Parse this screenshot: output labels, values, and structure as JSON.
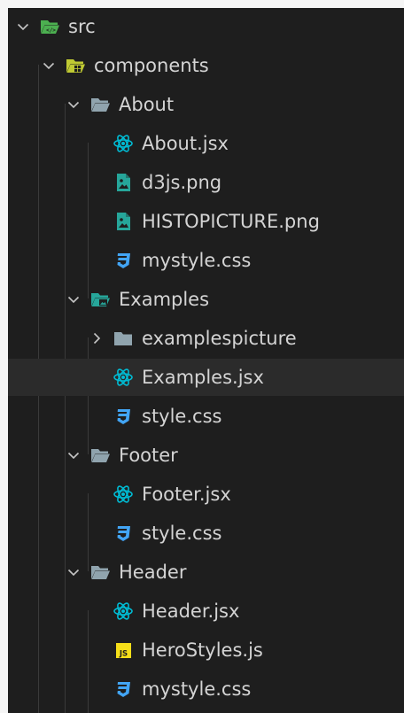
{
  "explorer": {
    "items": [
      {
        "label": "src",
        "kind": "folder",
        "expanded": true,
        "icon": "src-folder-open-icon",
        "depth": 0
      },
      {
        "label": "components",
        "kind": "folder",
        "expanded": true,
        "icon": "components-folder-open-icon",
        "depth": 1
      },
      {
        "label": "About",
        "kind": "folder",
        "expanded": true,
        "icon": "folder-open-icon",
        "depth": 2
      },
      {
        "label": "About.jsx",
        "kind": "file",
        "icon": "react-icon",
        "depth": 3
      },
      {
        "label": "d3js.png",
        "kind": "file",
        "icon": "image-file-icon",
        "depth": 3
      },
      {
        "label": "HISTOPICTURE.png",
        "kind": "file",
        "icon": "image-file-icon",
        "depth": 3
      },
      {
        "label": "mystyle.css",
        "kind": "file",
        "icon": "css-icon",
        "depth": 3
      },
      {
        "label": "Examples",
        "kind": "folder",
        "expanded": true,
        "icon": "images-folder-open-icon",
        "depth": 2
      },
      {
        "label": "examplespicture",
        "kind": "folder",
        "expanded": false,
        "icon": "folder-closed-icon",
        "depth": 3
      },
      {
        "label": "Examples.jsx",
        "kind": "file",
        "icon": "react-icon",
        "depth": 3,
        "selected": true
      },
      {
        "label": "style.css",
        "kind": "file",
        "icon": "css-icon",
        "depth": 3
      },
      {
        "label": "Footer",
        "kind": "folder",
        "expanded": true,
        "icon": "folder-open-icon",
        "depth": 2
      },
      {
        "label": "Footer.jsx",
        "kind": "file",
        "icon": "react-icon",
        "depth": 3
      },
      {
        "label": "style.css",
        "kind": "file",
        "icon": "css-icon",
        "depth": 3
      },
      {
        "label": "Header",
        "kind": "folder",
        "expanded": true,
        "icon": "folder-open-icon",
        "depth": 2
      },
      {
        "label": "Header.jsx",
        "kind": "file",
        "icon": "react-icon",
        "depth": 3
      },
      {
        "label": "HeroStyles.js",
        "kind": "file",
        "icon": "javascript-icon",
        "depth": 3
      },
      {
        "label": "mystyle.css",
        "kind": "file",
        "icon": "css-icon",
        "depth": 3
      }
    ]
  },
  "colors": {
    "background": "#1e1e1e",
    "text": "#d4d4d4",
    "chevron": "#c5c5c5",
    "selected_row": "#2b2b2b",
    "react": "#00bcd4",
    "css": "#42a5f5",
    "image": "#26a69a",
    "javascript": "#f5de19",
    "folder": "#90a4ae",
    "src_folder": "#4caf50",
    "components_folder": "#c0ca33"
  }
}
